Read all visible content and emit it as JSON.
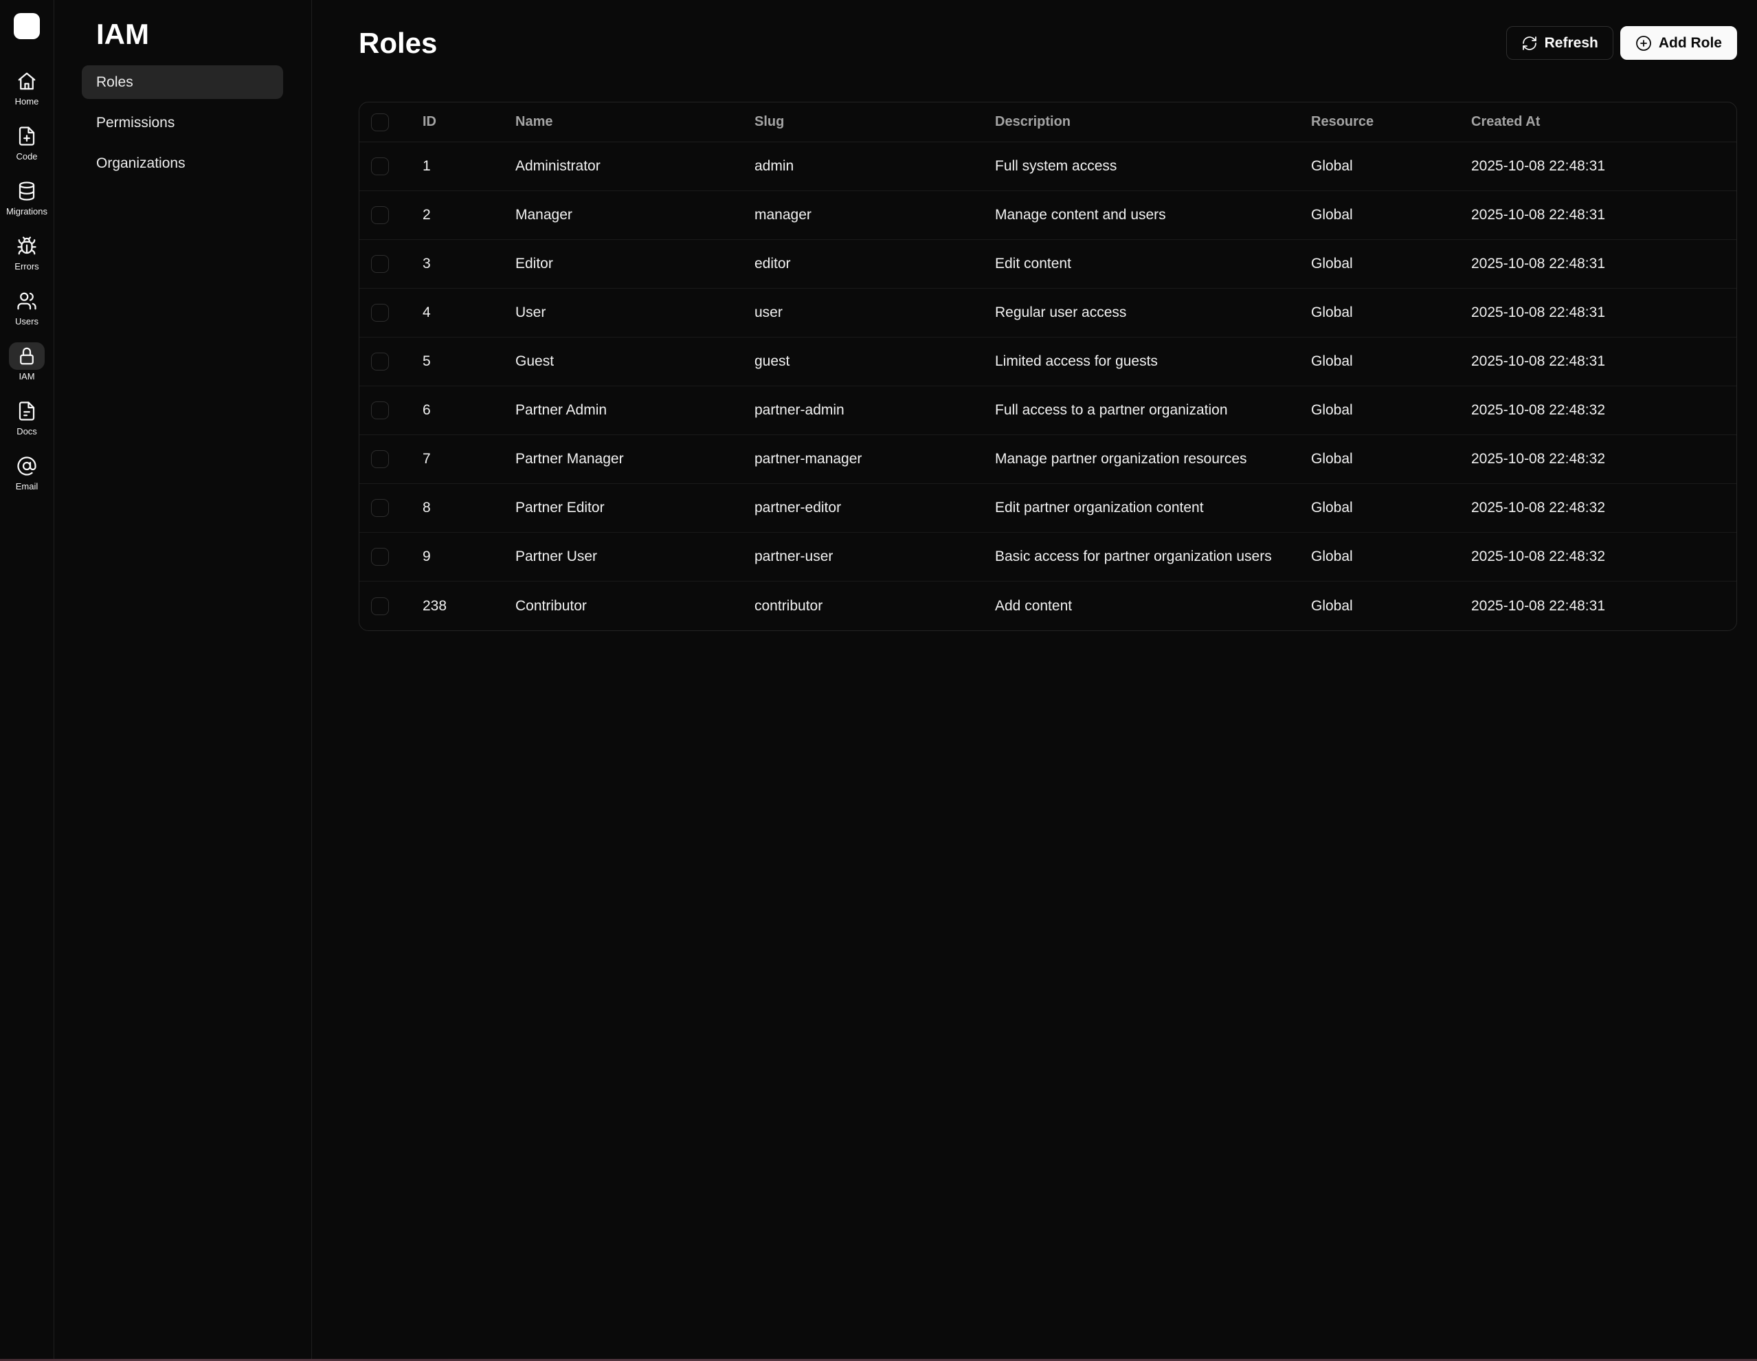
{
  "colors": {
    "background": "#0a0a0a",
    "panel_highlight": "#262626",
    "rail_highlight": "#2b2b2b",
    "table_border": "#242424",
    "divider": "#1f1f1f",
    "accent": "#fafafa",
    "muted_text": "#a4a4a4",
    "bottom_bar": "#4a2f38"
  },
  "rail": {
    "items": [
      {
        "icon": "home-icon",
        "label": "Home",
        "active": false
      },
      {
        "icon": "file-plus-icon",
        "label": "Code",
        "active": false
      },
      {
        "icon": "database-icon",
        "label": "Migrations",
        "active": false
      },
      {
        "icon": "bug-icon",
        "label": "Errors",
        "active": false
      },
      {
        "icon": "users-icon",
        "label": "Users",
        "active": false
      },
      {
        "icon": "lock-icon",
        "label": "IAM",
        "active": true
      },
      {
        "icon": "file-text-icon",
        "label": "Docs",
        "active": false
      },
      {
        "icon": "at-sign-icon",
        "label": "Email",
        "active": false
      }
    ]
  },
  "panel": {
    "title": "IAM",
    "items": [
      {
        "label": "Roles",
        "active": true
      },
      {
        "label": "Permissions",
        "active": false
      },
      {
        "label": "Organizations",
        "active": false
      }
    ]
  },
  "main": {
    "title": "Roles",
    "refresh_label": "Refresh",
    "add_label": "Add Role"
  },
  "table": {
    "headers": [
      "ID",
      "Name",
      "Slug",
      "Description",
      "Resource",
      "Created At"
    ],
    "rows": [
      {
        "id": "1",
        "name": "Administrator",
        "slug": "admin",
        "description": "Full system access",
        "resource": "Global",
        "created_at": "2025-10-08 22:48:31"
      },
      {
        "id": "2",
        "name": "Manager",
        "slug": "manager",
        "description": "Manage content and users",
        "resource": "Global",
        "created_at": "2025-10-08 22:48:31"
      },
      {
        "id": "3",
        "name": "Editor",
        "slug": "editor",
        "description": "Edit content",
        "resource": "Global",
        "created_at": "2025-10-08 22:48:31"
      },
      {
        "id": "4",
        "name": "User",
        "slug": "user",
        "description": "Regular user access",
        "resource": "Global",
        "created_at": "2025-10-08 22:48:31"
      },
      {
        "id": "5",
        "name": "Guest",
        "slug": "guest",
        "description": "Limited access for guests",
        "resource": "Global",
        "created_at": "2025-10-08 22:48:31"
      },
      {
        "id": "6",
        "name": "Partner Admin",
        "slug": "partner-admin",
        "description": "Full access to a partner organization",
        "resource": "Global",
        "created_at": "2025-10-08 22:48:32"
      },
      {
        "id": "7",
        "name": "Partner Manager",
        "slug": "partner-manager",
        "description": "Manage partner organization resources",
        "resource": "Global",
        "created_at": "2025-10-08 22:48:32"
      },
      {
        "id": "8",
        "name": "Partner Editor",
        "slug": "partner-editor",
        "description": "Edit partner organization content",
        "resource": "Global",
        "created_at": "2025-10-08 22:48:32"
      },
      {
        "id": "9",
        "name": "Partner User",
        "slug": "partner-user",
        "description": "Basic access for partner organization users",
        "resource": "Global",
        "created_at": "2025-10-08 22:48:32"
      },
      {
        "id": "238",
        "name": "Contributor",
        "slug": "contributor",
        "description": "Add content",
        "resource": "Global",
        "created_at": "2025-10-08 22:48:31"
      }
    ]
  }
}
